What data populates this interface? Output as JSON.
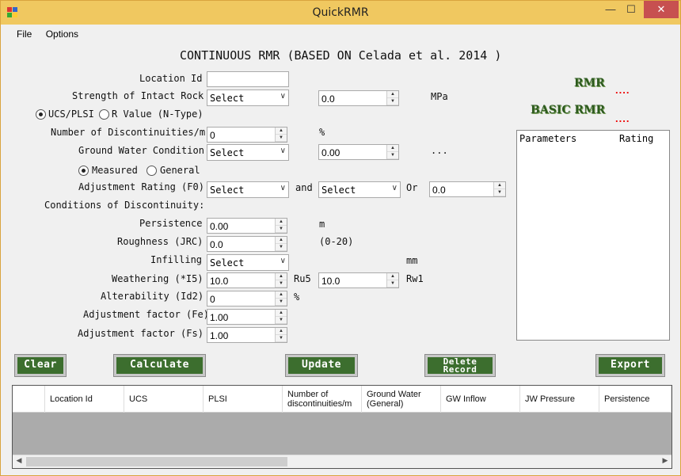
{
  "window": {
    "title": "QuickRMR"
  },
  "menu": {
    "file": "File",
    "options": "Options"
  },
  "heading": "CONTINUOUS RMR (BASED ON Celada et al. 2014 )",
  "form": {
    "location_id": {
      "label": "Location Id",
      "value": ""
    },
    "strength": {
      "label": "Strength of Intact Rock",
      "select": "Select",
      "value": "0.0",
      "unit": "MPa"
    },
    "radio_ucs": "UCS/PLSI",
    "radio_rvalue": "R Value (N-Type)",
    "discontinuities": {
      "label": "Number of Discontinuities/m",
      "value": "0",
      "unit": "%"
    },
    "ground_water": {
      "label": "Ground Water Condition",
      "select": "Select",
      "value": "0.00",
      "unit": "..."
    },
    "radio_measured": "Measured",
    "radio_general": "General",
    "adjustment_rating": {
      "label": "Adjustment Rating (F0)",
      "select1": "Select",
      "and": "and",
      "select2": "Select",
      "or": "Or",
      "value": "0.0"
    },
    "conditions_label": "Conditions of Discontinuity:",
    "persistence": {
      "label": "Persistence",
      "value": "0.00",
      "unit": "m"
    },
    "roughness": {
      "label": "Roughness (JRC)",
      "value": "0.0",
      "unit": "(0-20)"
    },
    "infilling": {
      "label": "Infilling",
      "select": "Select",
      "unit": "mm"
    },
    "weathering": {
      "label": "Weathering (*I5)",
      "value": "10.0",
      "unit1": "Ru5",
      "value2": "10.0",
      "unit2": "Rw1"
    },
    "alterability": {
      "label": "Alterability (Id2)",
      "value": "0",
      "unit": "%"
    },
    "adj_fe": {
      "label": "Adjustment factor (Fe)",
      "value": "1.00"
    },
    "adj_fs": {
      "label": "Adjustment factor (Fs)",
      "value": "1.00"
    }
  },
  "results": {
    "rmr_label": "RMR",
    "rmr_value": "....",
    "basic_rmr_label": "BASIC RMR",
    "basic_rmr_value": "....",
    "panel_col1": "Parameters",
    "panel_col2": "Rating"
  },
  "buttons": {
    "clear": "Clear",
    "calculate": "Calculate",
    "update": "Update",
    "delete_line1": "Delete",
    "delete_line2": "Record",
    "export": "Export"
  },
  "table": {
    "columns": [
      "Location Id",
      "UCS",
      "PLSI",
      "Number of discontinuities/m",
      "Ground Water (General)",
      "GW Inflow",
      "JW Pressure",
      "Persistence"
    ]
  },
  "colors": {
    "title_bar": "#f0c860",
    "button_green": "#3c6e2e",
    "close_red": "#c75050",
    "rmr_dots": "#e00000"
  }
}
